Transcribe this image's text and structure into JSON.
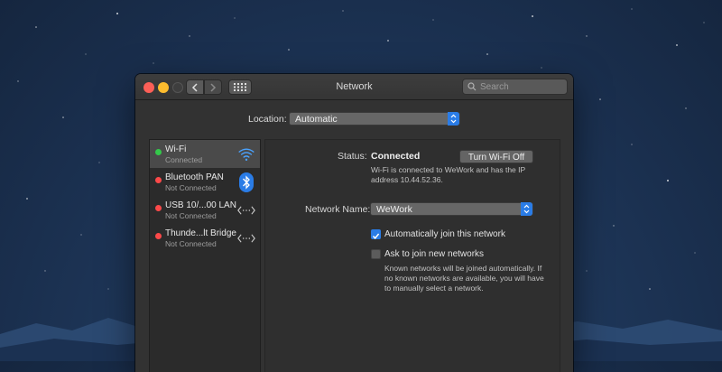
{
  "window": {
    "title": "Network"
  },
  "search": {
    "placeholder": "Search"
  },
  "location": {
    "label": "Location:",
    "value": "Automatic"
  },
  "services": [
    {
      "name": "Wi-Fi",
      "status": "Connected",
      "dot_color": "#34c84a",
      "icon": "wifi-icon",
      "selected": true
    },
    {
      "name": "Bluetooth PAN",
      "status": "Not Connected",
      "dot_color": "#fc4949",
      "icon": "bluetooth-icon",
      "selected": false
    },
    {
      "name": "USB 10/...00 LAN",
      "status": "Not Connected",
      "dot_color": "#fc4949",
      "icon": "ethernet-arrows-icon",
      "selected": false
    },
    {
      "name": "Thunde...lt Bridge",
      "status": "Not Connected",
      "dot_color": "#fc4949",
      "icon": "ethernet-arrows-icon",
      "selected": false
    }
  ],
  "detail": {
    "status_label": "Status:",
    "status_value": "Connected",
    "turn_off_button": "Turn Wi-Fi Off",
    "status_description_line1": "Wi-Fi is connected to WeWork and has the IP",
    "status_description_line2": "address 10.44.52.36.",
    "network_name_label": "Network Name:",
    "network_name_value": "WeWork",
    "auto_join_label": "Automatically join this network",
    "auto_join_checked": true,
    "ask_join_label": "Ask to join new networks",
    "ask_join_checked": false,
    "ask_join_note_line1": "Known networks will be joined automatically. If",
    "ask_join_note_line2": "no known networks are available, you will have",
    "ask_join_note_line3": "to manually select a network."
  },
  "colors": {
    "accent": "#2a7ce6",
    "close": "#fc5f57",
    "minimize": "#fdbc2e"
  }
}
